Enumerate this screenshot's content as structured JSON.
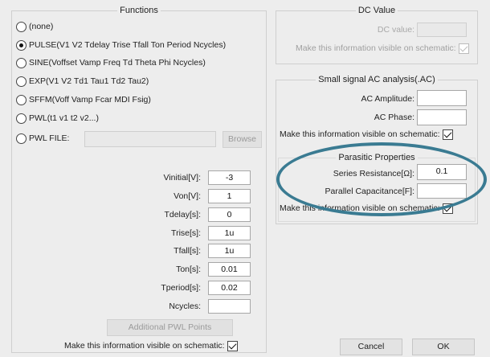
{
  "functions": {
    "title": "Functions",
    "options": [
      {
        "label": "(none)",
        "checked": false
      },
      {
        "label": "PULSE(V1 V2 Tdelay Trise Tfall Ton Period Ncycles)",
        "checked": true
      },
      {
        "label": "SINE(Voffset Vamp Freq Td Theta Phi Ncycles)",
        "checked": false
      },
      {
        "label": "EXP(V1 V2 Td1 Tau1 Td2 Tau2)",
        "checked": false
      },
      {
        "label": "SFFM(Voff Vamp Fcar MDI Fsig)",
        "checked": false
      },
      {
        "label": "PWL(t1 v1 t2 v2...)",
        "checked": false
      },
      {
        "label": "PWL FILE:",
        "checked": false
      }
    ],
    "browse_label": "Browse",
    "params": [
      {
        "label": "Vinitial[V]:",
        "value": "-3"
      },
      {
        "label": "Von[V]:",
        "value": "1"
      },
      {
        "label": "Tdelay[s]:",
        "value": "0"
      },
      {
        "label": "Trise[s]:",
        "value": "1u"
      },
      {
        "label": "Tfall[s]:",
        "value": "1u"
      },
      {
        "label": "Ton[s]:",
        "value": "0.01"
      },
      {
        "label": "Tperiod[s]:",
        "value": "0.02"
      },
      {
        "label": "Ncycles:",
        "value": ""
      }
    ],
    "pwl_button_label": "Additional PWL Points",
    "visible_label": "Make this information visible on schematic:",
    "visible_checked": true
  },
  "dc": {
    "title": "DC Value",
    "value_label": "DC value:",
    "value": "",
    "visible_label": "Make this information visible on schematic:",
    "visible_checked": true
  },
  "ac": {
    "title": "Small signal AC analysis(.AC)",
    "amplitude_label": "AC Amplitude:",
    "amplitude_value": "",
    "phase_label": "AC Phase:",
    "phase_value": "",
    "visible_label": "Make this information visible on schematic:",
    "visible_checked": true
  },
  "parasitic": {
    "title": "Parasitic Properties",
    "series_label": "Series Resistance[Ω]:",
    "series_value": "0.1",
    "parallel_label": "Parallel Capacitance[F]:",
    "parallel_value": "",
    "visible_label": "Make this information visible on schematic:",
    "visible_checked": true
  },
  "buttons": {
    "cancel": "Cancel",
    "ok": "OK"
  },
  "colors": {
    "annotation_ellipse": "#3a7b92"
  }
}
